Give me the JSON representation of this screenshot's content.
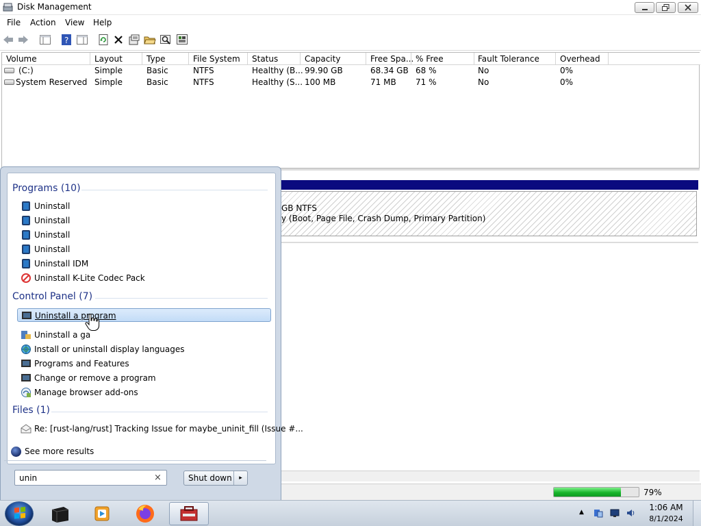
{
  "window": {
    "title": "Disk Management",
    "buttons": {
      "minimize": "minimize",
      "maximize": "maximize",
      "close": "close"
    }
  },
  "menubar": [
    "File",
    "Action",
    "View",
    "Help"
  ],
  "toolbar": {
    "icons": [
      "back-arrow-icon",
      "forward-arrow-icon",
      "console-tree-icon",
      "help-icon",
      "list-view-icon",
      "refresh-icon",
      "delete-icon",
      "properties-icon",
      "open-folder-icon",
      "search-icon",
      "settings-icon"
    ]
  },
  "volume_list": {
    "columns": [
      "Volume",
      "Layout",
      "Type",
      "File System",
      "Status",
      "Capacity",
      "Free Spa...",
      "% Free",
      "Fault Tolerance",
      "Overhead"
    ],
    "rows": [
      [
        "(C:)",
        "Simple",
        "Basic",
        "NTFS",
        "Healthy (B...",
        "99.90 GB",
        "68.34 GB",
        "68 %",
        "No",
        "0%"
      ],
      [
        "System Reserved",
        "Simple",
        "Basic",
        "NTFS",
        "Healthy (S...",
        "100 MB",
        "71 MB",
        "71 %",
        "No",
        "0%"
      ]
    ]
  },
  "disk_view": {
    "partition_line1": "GB NTFS",
    "partition_line2": "y (Boot, Page File, Crash Dump, Primary Partition)"
  },
  "statusbar": {
    "progress_percent": 79,
    "progress_text": "79%"
  },
  "start_menu": {
    "groups": [
      {
        "title": "Programs (10)",
        "items": [
          {
            "label": "Uninstall",
            "icon": "program-icon"
          },
          {
            "label": "Uninstall",
            "icon": "program-icon"
          },
          {
            "label": "Uninstall",
            "icon": "program-icon"
          },
          {
            "label": "Uninstall",
            "icon": "program-icon"
          },
          {
            "label": "Uninstall IDM",
            "icon": "program-icon"
          },
          {
            "label": "Uninstall K-Lite Codec Pack",
            "icon": "klite-icon"
          }
        ]
      },
      {
        "title": "Control Panel (7)",
        "items": [
          {
            "label": "Uninstall a program",
            "icon": "programs-features-icon",
            "selected": true
          },
          {
            "label": "Uninstall a gadget",
            "icon": "gadget-icon"
          },
          {
            "label": "Install or uninstall display languages",
            "icon": "language-icon"
          },
          {
            "label": "Programs and Features",
            "icon": "programs-features-icon"
          },
          {
            "label": "Change or remove a program",
            "icon": "programs-features-icon"
          },
          {
            "label": "Manage browser add-ons",
            "icon": "browser-addons-icon"
          }
        ]
      },
      {
        "title": "Files (1)",
        "items": [
          {
            "label": "Re: [rust-lang/rust] Tracking Issue for maybe_uninit_fill (Issue #...",
            "icon": "mail-icon"
          }
        ]
      }
    ],
    "see_more": "See more results",
    "search_value": "unin",
    "search_clear": "×",
    "shutdown_label": "Shut down",
    "shutdown_arrow": "▸"
  },
  "taskbar": {
    "apps": [
      "explorer-icon",
      "media-player-icon",
      "firefox-icon",
      "disk-management-icon"
    ],
    "time": "1:06 AM",
    "date": "8/1/2024",
    "tray_arrow": "▲"
  }
}
